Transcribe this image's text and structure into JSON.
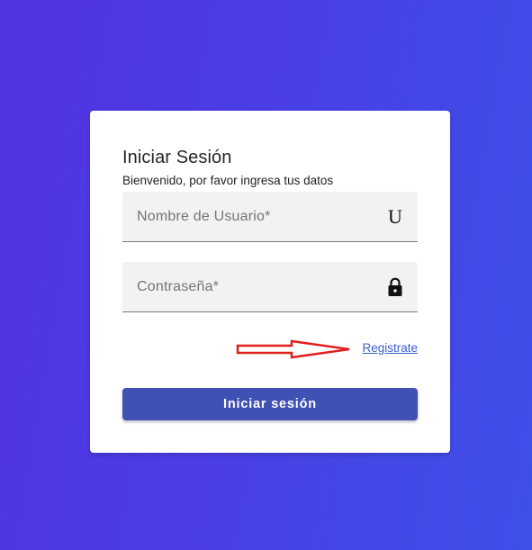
{
  "login": {
    "title": "Iniciar Sesión",
    "subtitle": "Bienvenido, por favor ingresa tus datos",
    "username": {
      "placeholder": "Nombre de Usuario*",
      "icon_text": "U",
      "icon": "u-letter-icon"
    },
    "password": {
      "placeholder": "Contraseña*",
      "icon": "lock-icon"
    },
    "register_link": "Registrate",
    "submit_label": "Iniciar sesión"
  },
  "annotation": {
    "arrow_icon": "red-arrow-icon",
    "arrow_color": "#e02020"
  },
  "colors": {
    "background_gradient_start": "#5133df",
    "background_gradient_end": "#3e50e8",
    "primary_button": "#3f51b5",
    "link": "#3b5fd0"
  }
}
